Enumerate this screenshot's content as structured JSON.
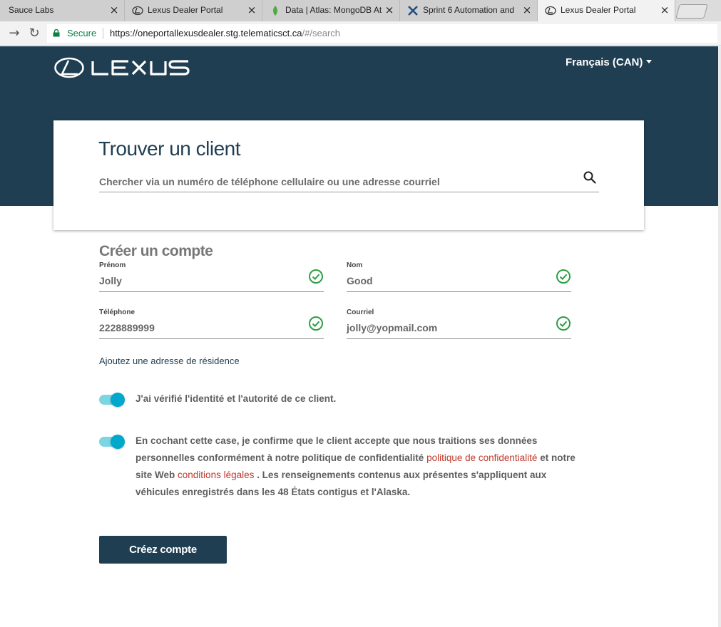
{
  "browser": {
    "tabs": [
      {
        "label": "Sauce Labs",
        "icon": "none",
        "active": false
      },
      {
        "label": "Lexus Dealer Portal",
        "icon": "lexus-logo-icon",
        "active": false
      },
      {
        "label": "Data | Atlas: MongoDB At",
        "icon": "mongodb-leaf-icon",
        "active": false
      },
      {
        "label": "Sprint 6 Automation and",
        "icon": "jira-icon",
        "active": false
      },
      {
        "label": "Lexus Dealer Portal",
        "icon": "lexus-logo-icon",
        "active": true
      }
    ],
    "close_glyph": "×",
    "secure_label": "Secure",
    "url_host": "https://oneportallexusdealer.stg.telematicsct.ca",
    "url_rest": "/#/search"
  },
  "header": {
    "brand": "LEXUS",
    "language": "Français (CAN)"
  },
  "search": {
    "title": "Trouver un client",
    "placeholder": "Chercher via un numéro de téléphone cellulaire ou une adresse courriel"
  },
  "create": {
    "title": "Créer un compte",
    "fields": {
      "first_name": {
        "label": "Prénom",
        "value": "Jolly",
        "valid": true
      },
      "last_name": {
        "label": "Nom",
        "value": "Good",
        "valid": true
      },
      "phone": {
        "label": "Téléphone",
        "value": "2228889999",
        "valid": true
      },
      "email": {
        "label": "Courriel",
        "value": "jolly@yopmail.com",
        "valid": true
      }
    },
    "add_address_link": "Ajoutez une adresse de résidence",
    "toggle_identity": {
      "on": true,
      "text": "J'ai vérifié l'identité et l'autorité de ce client."
    },
    "toggle_consent": {
      "on": true,
      "text_1": "En cochant cette case, je confirme que le client accepte que nous traitions ses données",
      "text_2": "personnelles conformément à notre politique de confidentialité",
      "privacy_link": "politique de confidentialité",
      "text_3": "et notre",
      "text_4": "site Web",
      "legal_link": "conditions légales",
      "text_5": ". Les renseignements contenus aux présentes s'appliquent aux",
      "text_6": "véhicules enregistrés dans les 48 États contigus et l'Alaska."
    },
    "submit_label": "Créez compte"
  },
  "colors": {
    "brand_navy": "#1f3e52",
    "toggle_on": "#00a8cc",
    "valid_green": "#2e9e44",
    "link_red": "#c0392b",
    "secure_green": "#0b8043"
  }
}
